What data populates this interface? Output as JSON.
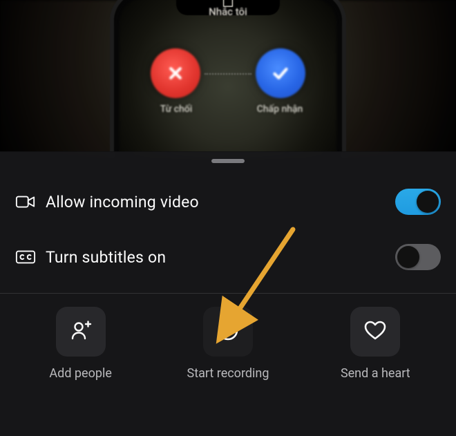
{
  "background_call": {
    "contact_label": "Nhắc tôi",
    "decline_label": "Từ chối",
    "accept_label": "Chấp nhận"
  },
  "settings": {
    "allow_video": {
      "label": "Allow incoming video",
      "on": true
    },
    "subtitles": {
      "label": "Turn subtitles on",
      "on": false
    }
  },
  "actions": {
    "add_people": {
      "label": "Add people"
    },
    "start_recording": {
      "label": "Start recording"
    },
    "send_heart": {
      "label": "Send a heart"
    }
  },
  "colors": {
    "accent": "#1f9be0",
    "annotation": "#e6a531"
  }
}
